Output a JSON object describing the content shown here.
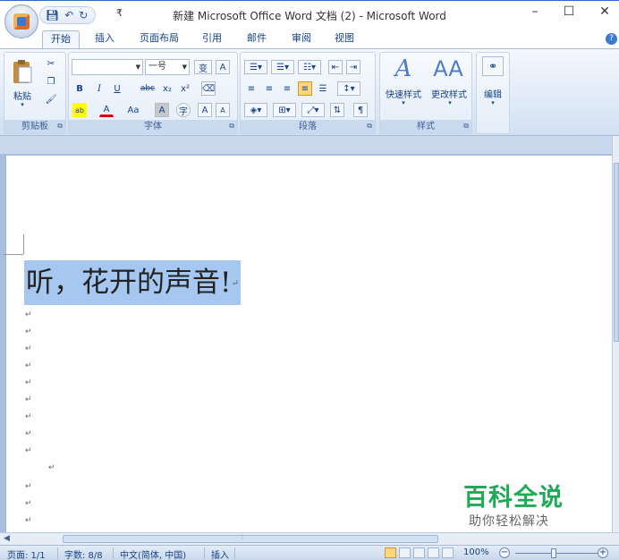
{
  "window": {
    "title": "新建 Microsoft Office Word 文档 (2) - Microsoft Word",
    "minimize": "–",
    "maximize": "☐",
    "close": "✕"
  },
  "quick_access": {
    "save_icon": "save-icon",
    "undo_icon": "undo-icon",
    "redo_icon": "redo-icon",
    "more": "₹"
  },
  "tabs": [
    "开始",
    "插入",
    "页面布局",
    "引用",
    "邮件",
    "审阅",
    "视图"
  ],
  "active_tab": "开始",
  "ribbon": {
    "clipboard": {
      "label": "剪贴板",
      "paste": "粘贴"
    },
    "font": {
      "label": "字体",
      "font_name_value": "",
      "font_size_value": "一号",
      "bold": "B",
      "italic": "I",
      "underline": "U",
      "strike": "abc",
      "subscript": "x₂",
      "superscript": "x²",
      "case": "Aa",
      "char_shading": "A",
      "enclosed": "字",
      "grow": "A",
      "shrink": "A",
      "highlight_color": "#ffff00",
      "font_color": "#e00000"
    },
    "paragraph": {
      "label": "段落"
    },
    "styles": {
      "label": "样式",
      "quick_styles": "快速样式",
      "change_styles": "更改样式"
    },
    "editing": {
      "label": "编辑"
    }
  },
  "document": {
    "text": "听，花开的声音!",
    "paragraph_mark": "↵"
  },
  "watermark": {
    "title": "百科全说",
    "subtitle": "助你轻松解决"
  },
  "statusbar": {
    "page": "页面: 1/1",
    "words": "字数: 8/8",
    "language": "中文(简体, 中国)",
    "mode": "插入",
    "zoom": "100%",
    "zoom_out": "−",
    "zoom_in": "+"
  }
}
